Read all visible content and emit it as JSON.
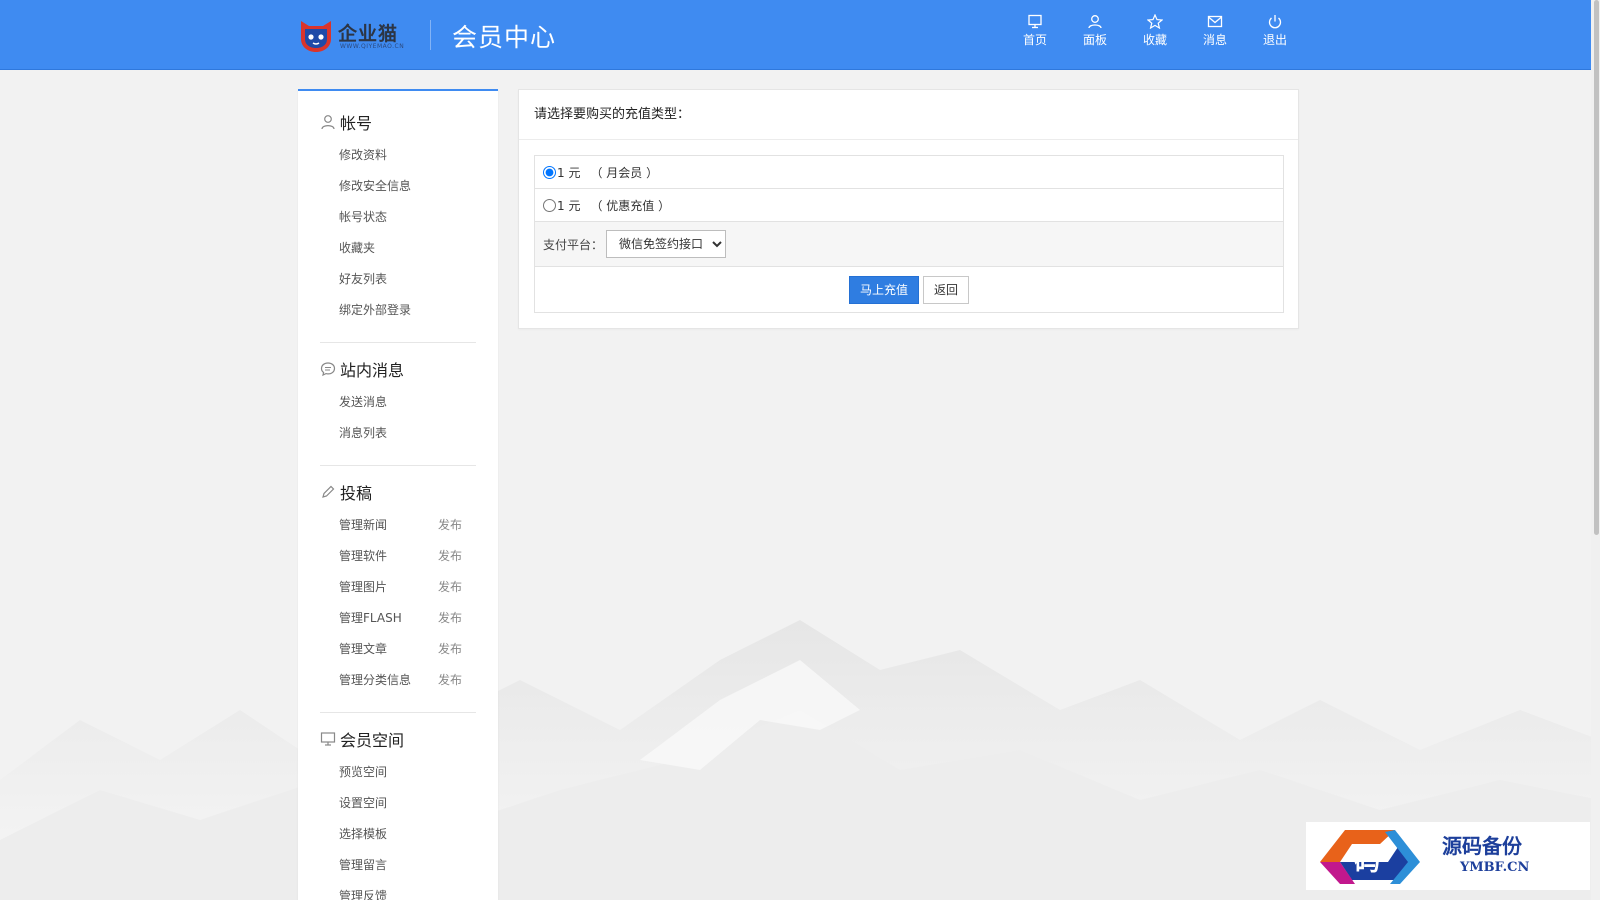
{
  "header": {
    "logo_text": "企业猫",
    "logo_sub": "WWW.QIYEMAO.CN",
    "title": "会员中心",
    "nav": [
      {
        "label": "首页",
        "icon": "monitor-icon"
      },
      {
        "label": "面板",
        "icon": "user-icon"
      },
      {
        "label": "收藏",
        "icon": "star-icon"
      },
      {
        "label": "消息",
        "icon": "mail-icon"
      },
      {
        "label": "退出",
        "icon": "power-icon"
      }
    ]
  },
  "sidebar": {
    "account": {
      "title": "帐号",
      "items": [
        "修改资料",
        "修改安全信息",
        "帐号状态",
        "收藏夹",
        "好友列表",
        "绑定外部登录"
      ]
    },
    "messages": {
      "title": "站内消息",
      "items": [
        "发送消息",
        "消息列表"
      ]
    },
    "posts": {
      "title": "投稿",
      "publish_label": "发布",
      "items": [
        "管理新闻",
        "管理软件",
        "管理图片",
        "管理FLASH",
        "管理文章",
        "管理分类信息"
      ]
    },
    "space": {
      "title": "会员空间",
      "items": [
        "预览空间",
        "设置空间",
        "选择模板",
        "管理留言",
        "管理反馈"
      ]
    }
  },
  "main": {
    "title": "请选择要购买的充值类型：",
    "options": [
      {
        "price": "1 元",
        "note": "（ 月会员 ）",
        "checked": true
      },
      {
        "price": "1 元",
        "note": "（ 优惠充值 ）",
        "checked": false
      }
    ],
    "pay_label": "支付平台：",
    "pay_selected": "微信免签约接口",
    "submit_label": "马上充值",
    "back_label": "返回"
  },
  "watermark": {
    "glyph": "码",
    "text": "源码备份",
    "sub": "YMBF.CN"
  },
  "colors": {
    "header_bg": "#3f8bf1",
    "primary_button": "#2f7de1",
    "page_bg": "#f2f2f2"
  }
}
